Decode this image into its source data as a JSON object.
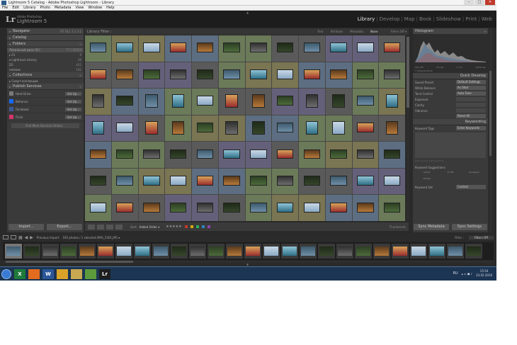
{
  "window": {
    "title": "Lightroom 5 Catalog - Adobe Photoshop Lightroom - Library",
    "minimize": "–",
    "maximize": "□",
    "close": "✕"
  },
  "menu": [
    "File",
    "Edit",
    "Library",
    "Photo",
    "Metadata",
    "View",
    "Window",
    "Help"
  ],
  "identity": {
    "logo": "Lr",
    "vendor": "Adobe Photoshop",
    "product": "Lightroom 5"
  },
  "modules": [
    {
      "label": "Library",
      "active": true
    },
    {
      "label": "Develop",
      "active": false
    },
    {
      "label": "Map",
      "active": false
    },
    {
      "label": "Book",
      "active": false
    },
    {
      "label": "Slideshow",
      "active": false
    },
    {
      "label": "Print",
      "active": false
    },
    {
      "label": "Web",
      "active": false
    }
  ],
  "left": {
    "navigator": "Navigator",
    "navigator_opts": "FIT   FILL   1:1   3:1",
    "catalog": "Catalog",
    "folders": "Folders",
    "folder_rows": [
      {
        "label": "Локальный диск (D:)",
        "n": "77 / 16234"
      },
      {
        "label": "▸ 01",
        "n": "9"
      },
      {
        "label": "▾ Lightroom Library",
        "n": "36"
      },
      {
        "label": "  D2",
        "n": "431"
      },
      {
        "label": "  пейзаж",
        "n": "192"
      }
    ],
    "collections": "Collections",
    "collection_rows": [
      {
        "label": "▸ Смарт-коллекции",
        "n": ""
      }
    ],
    "publish": "Publish Services",
    "publish_rows": [
      {
        "label": "Hard Drive",
        "btn": "Set Up...",
        "color": "#7a7a7a"
      },
      {
        "label": "Behance",
        "btn": "Set Up...",
        "color": "#1769ff"
      },
      {
        "label": "Facebook",
        "btn": "Set Up...",
        "color": "#3b5998"
      },
      {
        "label": "Flickr",
        "btn": "Set Up...",
        "color": "#d6336c"
      }
    ],
    "find_more": "Find More Services Online...",
    "import": "Import...",
    "export": "Export..."
  },
  "filter": {
    "title": "Library Filter :",
    "items": [
      "Text",
      "Attribute",
      "Metadata",
      "None"
    ],
    "active": "None",
    "preset": "Filters Off ▾"
  },
  "toolbar": {
    "sort_label": "Sort:",
    "sort_value": "Added Order ▾",
    "stars": "★★★★★",
    "thumbnails": "Thumbnails"
  },
  "right": {
    "histogram": "Histogram",
    "hist_info": [
      "ISO 125",
      "4,5 мм",
      "f / 3,5",
      "1/250 сек"
    ],
    "original": "Original Photo",
    "quick_develop": "Quick Develop",
    "qd_rows": [
      {
        "label": "Saved Preset",
        "value": "Default Settings"
      },
      {
        "label": "White Balance",
        "value": "As Shot"
      },
      {
        "label": "Tone Control",
        "value": "Auto Tone"
      },
      {
        "label": "Exposure",
        "value": ""
      },
      {
        "label": "Clarity",
        "value": ""
      },
      {
        "label": "Vibrance",
        "value": ""
      },
      {
        "label": "",
        "value": "Reset All"
      }
    ],
    "keywording": "Keywording",
    "kw_tags": "Keyword Tags",
    "kw_tags_value": "Enter Keywords",
    "kw_placeholder": "Click here to add keywords",
    "kw_suggestions": "Keyword Suggestions",
    "kw_sugg_items": [
      "Armaz",
      "17:48",
      "исходник",
      "Armazi",
      "",
      ""
    ],
    "kw_set": "Keyword Set",
    "kw_set_value": "Custom",
    "sync_metadata": "Sync Metadata",
    "sync_settings": "Sync Settings"
  },
  "filmstrip": {
    "source": "Previous Import",
    "count": "192 photos / 1 selected /IMG_5301.JPG ▾",
    "filter_label": "Filter :",
    "filter_value": "Filters Off"
  },
  "taskbar": {
    "lang": "RU",
    "time": "15:54",
    "date": "23.02.2016",
    "apps": [
      {
        "label": "X",
        "color": "#1f7a3b"
      },
      {
        "label": "",
        "color": "#e36c1f"
      },
      {
        "label": "W",
        "color": "#2b579a"
      },
      {
        "label": "",
        "color": "#d9a329"
      },
      {
        "label": "",
        "color": "#c8a951"
      },
      {
        "label": "",
        "color": "#5c9a3b"
      },
      {
        "label": "Lr",
        "color": "#1e1e1e"
      }
    ]
  },
  "grid_cells": 84,
  "film_cells": 26
}
